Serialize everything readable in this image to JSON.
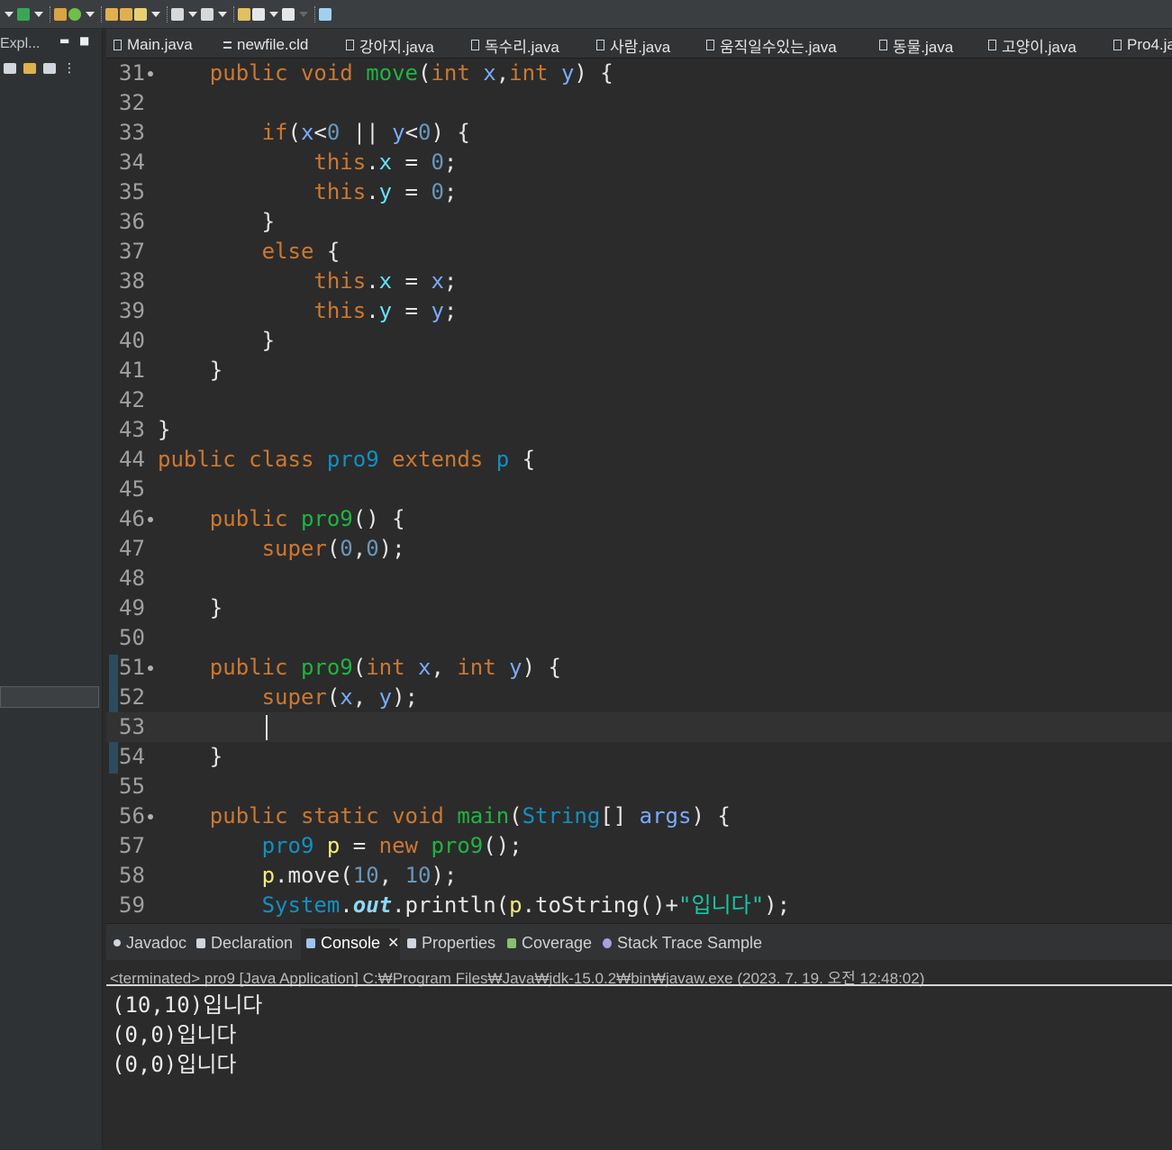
{
  "toolbar": {
    "icons": [
      "debug-icon",
      "run-icon",
      "new-package-icon",
      "refresh-icon",
      "open-folder-icon",
      "open-type-icon",
      "pencil-icon",
      "next-annotation-icon",
      "prev-annotation-icon",
      "last-edit-icon",
      "back-icon",
      "forward-icon",
      "new-window-icon"
    ]
  },
  "left_panel": {
    "title": "Expl..."
  },
  "editor_tabs": [
    "Main.java",
    "newfile.cld",
    "강아지.java",
    "독수리.java",
    "사람.java",
    "움직일수있는.java",
    "동물.java",
    "고양이.java",
    "Pro4.ja"
  ],
  "code_lines": [
    {
      "n": "31",
      "fold": true,
      "tokens": [
        [
          "plain",
          "    "
        ],
        [
          "kw",
          "public void "
        ],
        [
          "fn",
          "move"
        ],
        [
          "plain",
          "("
        ],
        [
          "kw",
          "int "
        ],
        [
          "var",
          "x"
        ],
        [
          "plain",
          ","
        ],
        [
          "kw",
          "int "
        ],
        [
          "var",
          "y"
        ],
        [
          "plain",
          ") {"
        ]
      ]
    },
    {
      "n": "32",
      "tokens": []
    },
    {
      "n": "33",
      "tokens": [
        [
          "plain",
          "        "
        ],
        [
          "kw",
          "if"
        ],
        [
          "plain",
          "("
        ],
        [
          "var",
          "x"
        ],
        [
          "plain",
          "<"
        ],
        [
          "num",
          "0"
        ],
        [
          "plain",
          " || "
        ],
        [
          "var",
          "y"
        ],
        [
          "plain",
          "<"
        ],
        [
          "num",
          "0"
        ],
        [
          "plain",
          ") {"
        ]
      ]
    },
    {
      "n": "34",
      "tokens": [
        [
          "plain",
          "            "
        ],
        [
          "kw",
          "this"
        ],
        [
          "plain",
          "."
        ],
        [
          "fld",
          "x"
        ],
        [
          "plain",
          " = "
        ],
        [
          "num",
          "0"
        ],
        [
          "plain",
          ";"
        ]
      ]
    },
    {
      "n": "35",
      "tokens": [
        [
          "plain",
          "            "
        ],
        [
          "kw",
          "this"
        ],
        [
          "plain",
          "."
        ],
        [
          "fld",
          "y"
        ],
        [
          "plain",
          " = "
        ],
        [
          "num",
          "0"
        ],
        [
          "plain",
          ";"
        ]
      ]
    },
    {
      "n": "36",
      "tokens": [
        [
          "plain",
          "        }"
        ]
      ]
    },
    {
      "n": "37",
      "tokens": [
        [
          "plain",
          "        "
        ],
        [
          "kw",
          "else"
        ],
        [
          "plain",
          " {"
        ]
      ]
    },
    {
      "n": "38",
      "tokens": [
        [
          "plain",
          "            "
        ],
        [
          "kw",
          "this"
        ],
        [
          "plain",
          "."
        ],
        [
          "fld",
          "x"
        ],
        [
          "plain",
          " = "
        ],
        [
          "var",
          "x"
        ],
        [
          "plain",
          ";"
        ]
      ]
    },
    {
      "n": "39",
      "tokens": [
        [
          "plain",
          "            "
        ],
        [
          "kw",
          "this"
        ],
        [
          "plain",
          "."
        ],
        [
          "fld",
          "y"
        ],
        [
          "plain",
          " = "
        ],
        [
          "var",
          "y"
        ],
        [
          "plain",
          ";"
        ]
      ]
    },
    {
      "n": "40",
      "tokens": [
        [
          "plain",
          "        }"
        ]
      ]
    },
    {
      "n": "41",
      "tokens": [
        [
          "plain",
          "    }"
        ]
      ]
    },
    {
      "n": "42",
      "tokens": []
    },
    {
      "n": "43",
      "tokens": [
        [
          "plain",
          "}"
        ]
      ]
    },
    {
      "n": "44",
      "tokens": [
        [
          "kw",
          "public class "
        ],
        [
          "typ",
          "pro9"
        ],
        [
          "kw",
          " extends "
        ],
        [
          "typ",
          "p"
        ],
        [
          "plain",
          " {"
        ]
      ]
    },
    {
      "n": "45",
      "tokens": []
    },
    {
      "n": "46",
      "fold": true,
      "tokens": [
        [
          "plain",
          "    "
        ],
        [
          "kw",
          "public "
        ],
        [
          "fn",
          "pro9"
        ],
        [
          "plain",
          "() {"
        ]
      ]
    },
    {
      "n": "47",
      "tokens": [
        [
          "plain",
          "        "
        ],
        [
          "kw",
          "super"
        ],
        [
          "plain",
          "("
        ],
        [
          "num",
          "0"
        ],
        [
          "plain",
          ","
        ],
        [
          "num",
          "0"
        ],
        [
          "plain",
          ");"
        ]
      ]
    },
    {
      "n": "48",
      "tokens": []
    },
    {
      "n": "49",
      "tokens": [
        [
          "plain",
          "    }"
        ]
      ]
    },
    {
      "n": "50",
      "tokens": []
    },
    {
      "n": "51",
      "fold": true,
      "tokens": [
        [
          "plain",
          "    "
        ],
        [
          "kw",
          "public "
        ],
        [
          "fn",
          "pro9"
        ],
        [
          "plain",
          "("
        ],
        [
          "kw",
          "int "
        ],
        [
          "var",
          "x"
        ],
        [
          "plain",
          ", "
        ],
        [
          "kw",
          "int "
        ],
        [
          "var",
          "y"
        ],
        [
          "plain",
          ") {"
        ]
      ]
    },
    {
      "n": "52",
      "tokens": [
        [
          "plain",
          "        "
        ],
        [
          "kw",
          "super"
        ],
        [
          "plain",
          "("
        ],
        [
          "var",
          "x"
        ],
        [
          "plain",
          ", "
        ],
        [
          "var",
          "y"
        ],
        [
          "plain",
          ");"
        ]
      ]
    },
    {
      "n": "53",
      "current": true,
      "tokens": []
    },
    {
      "n": "54",
      "tokens": [
        [
          "plain",
          "    }"
        ]
      ]
    },
    {
      "n": "55",
      "tokens": []
    },
    {
      "n": "56",
      "fold": true,
      "tokens": [
        [
          "plain",
          "    "
        ],
        [
          "kw",
          "public static void "
        ],
        [
          "fn",
          "main"
        ],
        [
          "plain",
          "("
        ],
        [
          "typ",
          "String"
        ],
        [
          "plain",
          "[] "
        ],
        [
          "var",
          "args"
        ],
        [
          "plain",
          ") {"
        ]
      ]
    },
    {
      "n": "57",
      "tokens": [
        [
          "plain",
          "        "
        ],
        [
          "typ",
          "pro9"
        ],
        [
          "plain",
          " "
        ],
        [
          "loc",
          "p"
        ],
        [
          "plain",
          " = "
        ],
        [
          "kw",
          "new "
        ],
        [
          "fn",
          "pro9"
        ],
        [
          "plain",
          "();"
        ]
      ]
    },
    {
      "n": "58",
      "tokens": [
        [
          "plain",
          "        "
        ],
        [
          "loc",
          "p"
        ],
        [
          "plain",
          "."
        ],
        [
          "plain",
          "move("
        ],
        [
          "num",
          "10"
        ],
        [
          "plain",
          ", "
        ],
        [
          "num",
          "10"
        ],
        [
          "plain",
          ");"
        ]
      ]
    },
    {
      "n": "59",
      "tokens": [
        [
          "plain",
          "        "
        ],
        [
          "typ",
          "System"
        ],
        [
          "plain",
          "."
        ],
        [
          "sfld",
          "out"
        ],
        [
          "plain",
          ".println("
        ],
        [
          "loc",
          "p"
        ],
        [
          "plain",
          ".toString()+"
        ],
        [
          "str",
          "\"입니다\""
        ],
        [
          "plain",
          ");"
        ]
      ]
    }
  ],
  "bottom_tabs": [
    "Javadoc",
    "Declaration",
    "Console",
    "Properties",
    "Coverage",
    "Stack Trace Sample"
  ],
  "console": {
    "status": "<terminated> pro9 [Java Application] C:₩Program Files₩Java₩jdk-15.0.2₩bin₩javaw.exe  (2023. 7. 19. 오전 12:48:02)",
    "output": [
      "(10,10)입니다",
      "(0,0)입니다",
      "(0,0)입니다"
    ]
  },
  "colors": {
    "keyword": "#cc7832",
    "method": "#1eb540",
    "field": "#66e1f8",
    "param": "#79abff",
    "local": "#f3ec79",
    "type": "#1290c3",
    "number": "#6897bb",
    "string": "#17c6a3"
  }
}
